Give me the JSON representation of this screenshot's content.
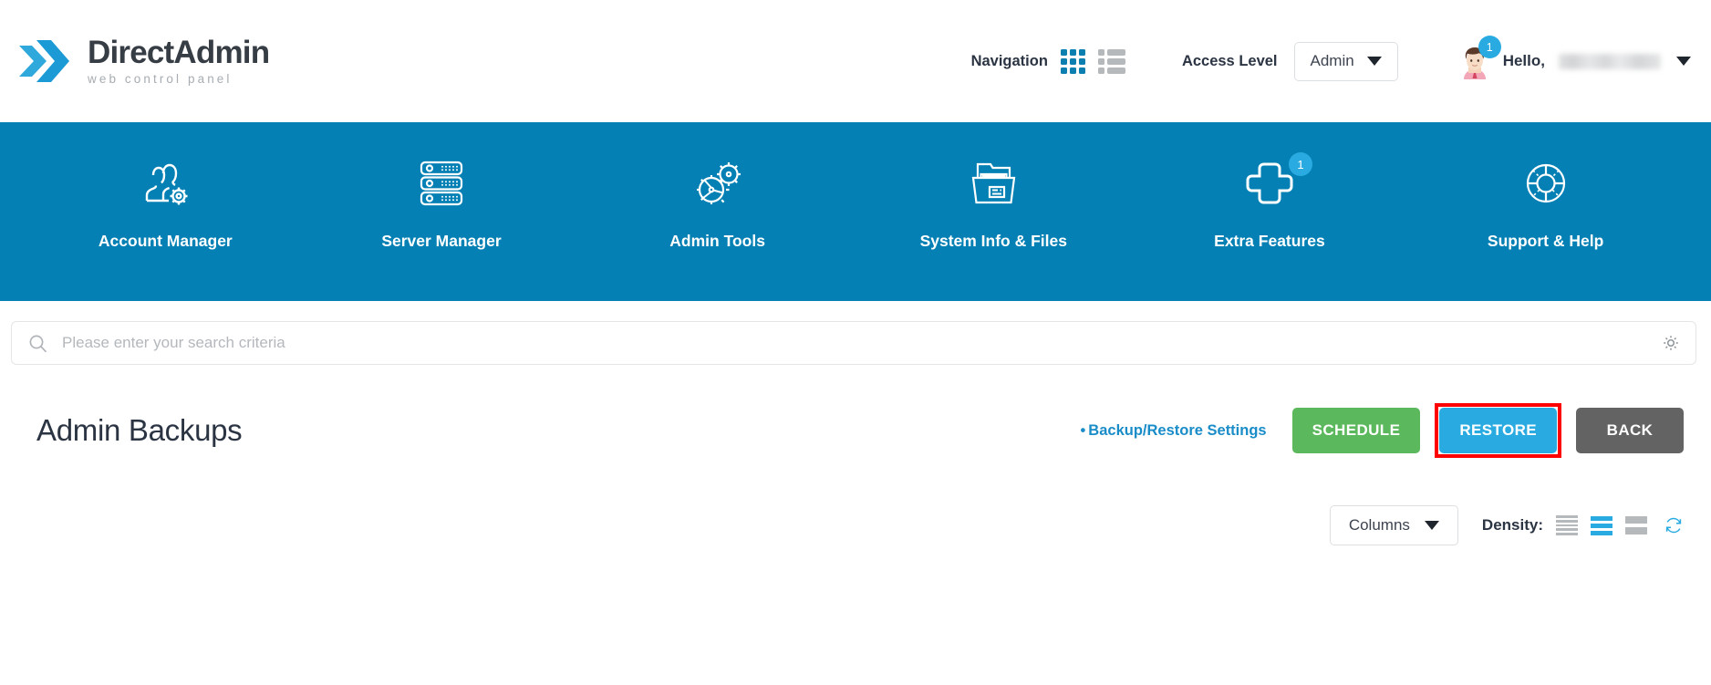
{
  "brand": {
    "name_part1": "Direct",
    "name_part2": "Admin",
    "tagline": "web control panel",
    "logo_icon": "double-chevron-logo",
    "color_light": "#2fa8dc",
    "color_dark": "#1c9ad6"
  },
  "header": {
    "navigation_label": "Navigation",
    "grid_view_icon": "grid-view-icon",
    "list_view_icon": "list-view-icon",
    "grid_view_active": true,
    "access_level_label": "Access Level",
    "access_level_value": "Admin",
    "access_level_caret_icon": "chevron-down-icon",
    "avatar_icon": "user-avatar",
    "avatar_badge_count": "1",
    "hello_label": "Hello,",
    "username_redacted": true,
    "user_caret_icon": "chevron-down-icon"
  },
  "main_nav": {
    "background_color": "#0480b4",
    "items": [
      {
        "label": "Account Manager",
        "icon": "users-gear-icon",
        "badge": null
      },
      {
        "label": "Server Manager",
        "icon": "server-rack-icon",
        "badge": null
      },
      {
        "label": "Admin Tools",
        "icon": "gears-icon",
        "badge": null
      },
      {
        "label": "System Info & Files",
        "icon": "file-folder-icon",
        "badge": null
      },
      {
        "label": "Extra Features",
        "icon": "plus-cross-icon",
        "badge": "1"
      },
      {
        "label": "Support & Help",
        "icon": "life-ring-icon",
        "badge": null
      }
    ]
  },
  "search": {
    "placeholder": "Please enter your search criteria",
    "value": "",
    "search_icon": "search-icon",
    "settings_icon": "gear-icon"
  },
  "page": {
    "title": "Admin Backups",
    "settings_link": "Backup/Restore Settings",
    "settings_link_bullet": "•",
    "buttons": [
      {
        "label": "SCHEDULE",
        "name": "schedule-button",
        "color": "#5cb85c",
        "highlighted": false
      },
      {
        "label": "RESTORE",
        "name": "restore-button",
        "color": "#29abe2",
        "highlighted": true
      },
      {
        "label": "BACK",
        "name": "back-button",
        "color": "#636363",
        "highlighted": false
      }
    ],
    "highlight_color": "#ff0000"
  },
  "table_toolbar": {
    "columns_label": "Columns",
    "columns_caret_icon": "chevron-down-icon",
    "density_label": "Density:",
    "density_options": [
      {
        "name": "density-compact",
        "icon": "density-compact-icon",
        "active": false
      },
      {
        "name": "density-medium",
        "icon": "density-medium-icon",
        "active": true
      },
      {
        "name": "density-comfortable",
        "icon": "density-comfortable-icon",
        "active": false
      }
    ],
    "refresh_icon": "refresh-icon",
    "active_color": "#29abe2"
  }
}
